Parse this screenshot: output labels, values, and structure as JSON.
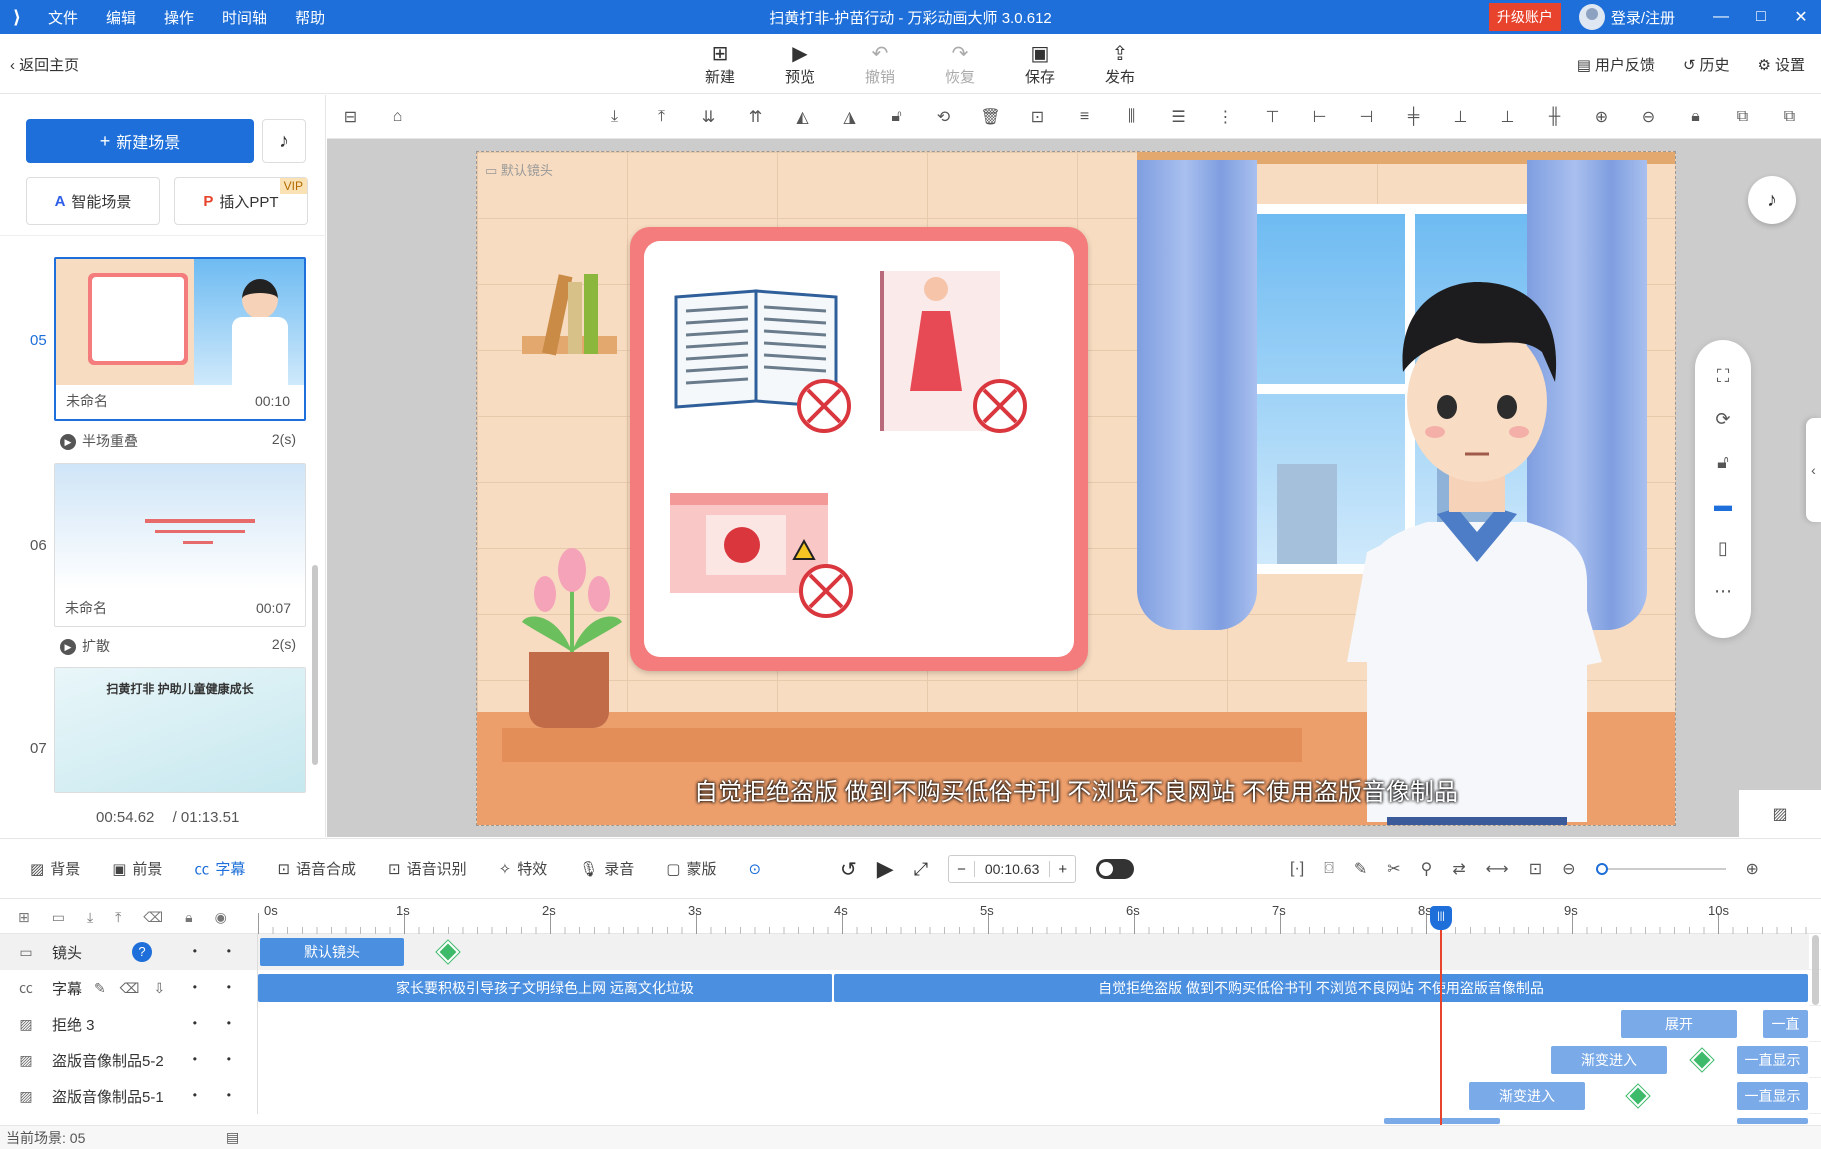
{
  "app": {
    "title": "扫黄打非-护苗行动 - 万彩动画大师 3.0.612",
    "menu": [
      "文件",
      "编辑",
      "操作",
      "时间轴",
      "帮助"
    ],
    "upgrade": "升级账户",
    "login": "登录/注册"
  },
  "toolbar": {
    "back": "返回主页",
    "actions": [
      {
        "label": "新建",
        "icon": "plus-square-icon",
        "enabled": true
      },
      {
        "label": "预览",
        "icon": "play-icon",
        "enabled": true
      },
      {
        "label": "撤销",
        "icon": "undo-icon",
        "enabled": false
      },
      {
        "label": "恢复",
        "icon": "redo-icon",
        "enabled": false
      },
      {
        "label": "保存",
        "icon": "save-icon",
        "enabled": true
      },
      {
        "label": "发布",
        "icon": "publish-icon",
        "enabled": true
      }
    ],
    "feedback": "用户反馈",
    "history": "历史",
    "settings": "设置"
  },
  "left": {
    "new_scene": "新建场景",
    "smart_scene": "智能场景",
    "insert_ppt": "插入PPT",
    "vip": "VIP",
    "scenes": [
      {
        "num": "05",
        "name": "未命名",
        "duration": "00:10",
        "transition": "半场重叠",
        "transition_time": "2(s)"
      },
      {
        "num": "06",
        "name": "未命名",
        "duration": "00:07",
        "transition": "扩散",
        "transition_time": "2(s)"
      },
      {
        "num": "07",
        "thumb_title": "扫黄打非 护助儿童健康成长"
      }
    ],
    "current_time": "00:54.62",
    "total_time": "/ 01:13.51"
  },
  "stage": {
    "camera_label": "默认镜头",
    "subtitle": "自觉拒绝盗版 做到不购买低俗书刊 不浏览不良网站 不使用盗版音像制品"
  },
  "timeline": {
    "tabs": [
      {
        "label": "背景",
        "icon": "background-icon"
      },
      {
        "label": "前景",
        "icon": "foreground-icon"
      },
      {
        "label": "字幕",
        "icon": "subtitle-icon",
        "active": true
      },
      {
        "label": "语音合成",
        "icon": "tts-icon"
      },
      {
        "label": "语音识别",
        "icon": "asr-icon"
      },
      {
        "label": "特效",
        "icon": "effects-icon"
      },
      {
        "label": "录音",
        "icon": "mic-icon"
      },
      {
        "label": "蒙版",
        "icon": "mask-icon"
      }
    ],
    "current_time": "00:10.63",
    "ruler": [
      "0s",
      "1s",
      "2s",
      "3s",
      "4s",
      "5s",
      "6s",
      "7s",
      "8s",
      "9s",
      "10s"
    ],
    "tracks": [
      {
        "name": "镜头",
        "clips": [
          "默认镜头"
        ]
      },
      {
        "name": "字幕",
        "clips": [
          "家长要积极引导孩子文明绿色上网 远离文化垃圾",
          "自觉拒绝盗版 做到不购买低俗书刊 不浏览不良网站 不使用盗版音像制品"
        ]
      },
      {
        "name": "拒绝 3",
        "clips": [
          "展开",
          "一直"
        ]
      },
      {
        "name": "盗版音像制品5-2",
        "clips": [
          "渐变进入",
          "一直显示"
        ]
      },
      {
        "name": "盗版音像制品5-1",
        "clips": [
          "渐变进入",
          "一直显示"
        ]
      }
    ]
  },
  "status": {
    "current_scene": "当前场景: 05"
  }
}
